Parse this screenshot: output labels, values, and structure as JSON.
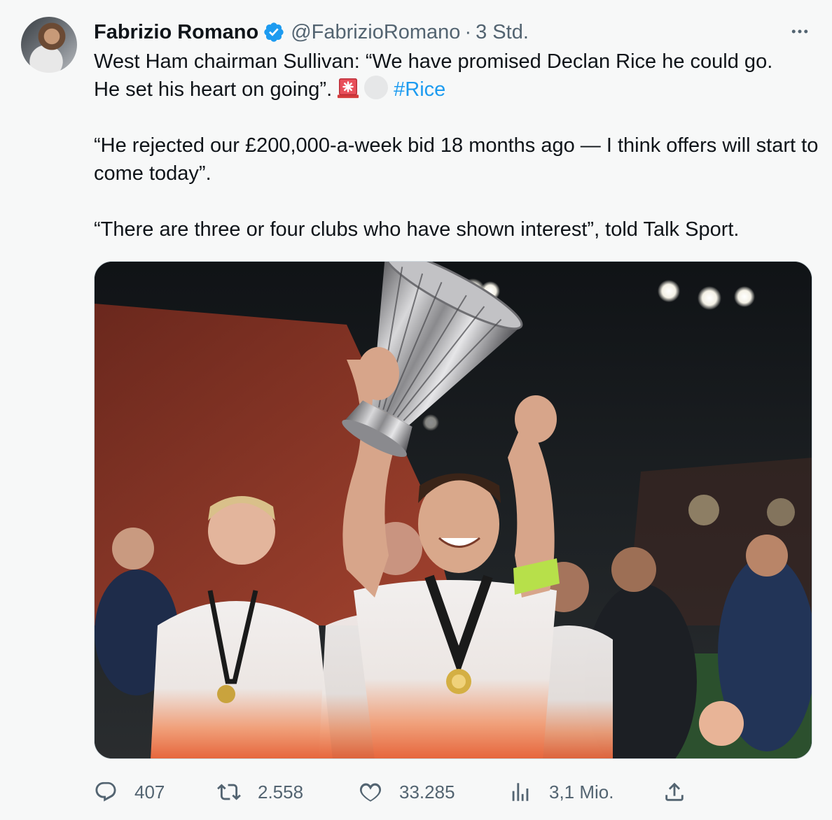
{
  "tweet": {
    "author": {
      "name": "Fabrizio Romano",
      "handle": "@FabrizioRomano",
      "separator": "·",
      "time": "3 Std.",
      "verified": true,
      "avatar_icon": "profile-photo"
    },
    "more_icon": "more-horizontal-icon",
    "text": {
      "p1_line1": "West Ham chairman Sullivan: “We have promised Declan Rice he could go.",
      "p1_line2": "He set his heart on going”.",
      "emojis": [
        "siren-emoji",
        "white-circle-emoji"
      ],
      "hashtag": "#Rice",
      "p2": "“He rejected our £200,000-a-week bid 18 months ago — I think offers will start to come today”.",
      "p3": "“There are three or four clubs who have shown interest”, told Talk Sport."
    },
    "media": {
      "type": "photo",
      "icon": "photo"
    },
    "actions": {
      "replies": "407",
      "retweets": "2.558",
      "likes": "33.285",
      "views": "3,1 Mio."
    },
    "colors": {
      "link": "#1d9bf0",
      "secondary_text": "#536471",
      "background": "#f7f8f8",
      "verified_badge": "#1d9bf0"
    }
  }
}
